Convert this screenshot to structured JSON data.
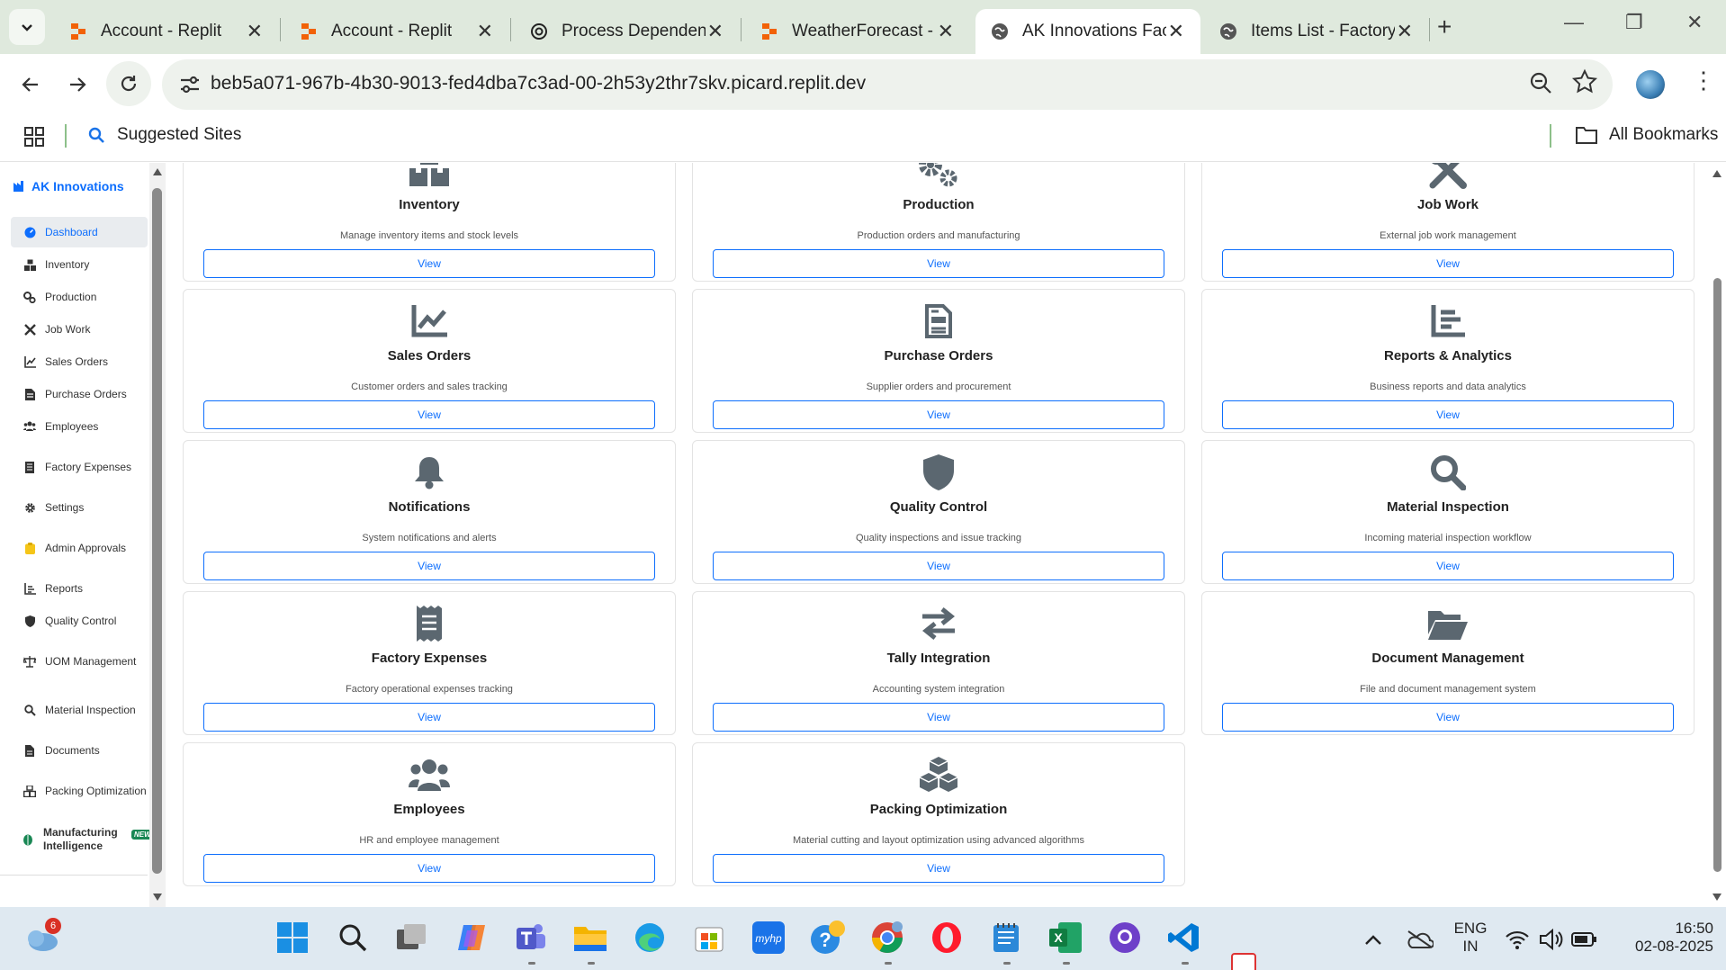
{
  "browser": {
    "tabs": [
      {
        "title": "Account - Replit",
        "favicon": "replit-icon",
        "active": false
      },
      {
        "title": "Account - Replit",
        "favicon": "replit-icon",
        "active": false
      },
      {
        "title": "Process Dependen",
        "favicon": "openai-icon",
        "active": false
      },
      {
        "title": "WeatherForecast -",
        "favicon": "replit-icon",
        "active": false
      },
      {
        "title": "AK Innovations Fac",
        "favicon": "globe-icon",
        "active": true
      },
      {
        "title": "Items List - Factory",
        "favicon": "globe-icon",
        "active": false
      }
    ],
    "url": "beb5a071-967b-4b30-9013-fed4dba7c3ad-00-2h53y2thr7skv.picard.replit.dev",
    "bookmarks": {
      "suggested": "Suggested Sites",
      "all": "All Bookmarks"
    }
  },
  "sidebar": {
    "brand": "AK Innovations",
    "items": [
      {
        "label": "Dashboard",
        "icon": "dashboard-icon",
        "active": true
      },
      {
        "label": "Inventory",
        "icon": "boxes-icon"
      },
      {
        "label": "Production",
        "icon": "cogs-icon"
      },
      {
        "label": "Job Work",
        "icon": "tools-icon"
      },
      {
        "label": "Sales Orders",
        "icon": "chart-line-icon"
      },
      {
        "label": "Purchase Orders",
        "icon": "file-invoice-icon"
      },
      {
        "label": "Employees",
        "icon": "users-icon"
      },
      {
        "label": "Factory Expenses",
        "icon": "receipt-icon"
      },
      {
        "label": "Settings",
        "icon": "gear-icon"
      },
      {
        "label": "Admin Approvals",
        "icon": "clipboard-icon"
      },
      {
        "label": "Reports",
        "icon": "chart-bar-icon"
      },
      {
        "label": "Quality Control",
        "icon": "shield-icon"
      },
      {
        "label": "UOM Management",
        "icon": "balance-scale-icon"
      },
      {
        "label": "Material Inspection",
        "icon": "search-icon"
      },
      {
        "label": "Documents",
        "icon": "file-icon"
      },
      {
        "label": "Packing Optimization",
        "icon": "cubes-icon"
      }
    ],
    "special": {
      "label_line1": "Manufacturing",
      "label_line2": "Intelligence",
      "badge": "NEW",
      "icon": "brain-icon"
    }
  },
  "cards": [
    {
      "title": "Inventory",
      "desc": "Manage inventory items and stock levels",
      "button": "View",
      "icon": "boxes-icon"
    },
    {
      "title": "Production",
      "desc": "Production orders and manufacturing",
      "button": "View",
      "icon": "cogs-icon"
    },
    {
      "title": "Job Work",
      "desc": "External job work management",
      "button": "View",
      "icon": "tools-icon"
    },
    {
      "title": "Sales Orders",
      "desc": "Customer orders and sales tracking",
      "button": "View",
      "icon": "chart-line-icon"
    },
    {
      "title": "Purchase Orders",
      "desc": "Supplier orders and procurement",
      "button": "View",
      "icon": "file-invoice-icon"
    },
    {
      "title": "Reports & Analytics",
      "desc": "Business reports and data analytics",
      "button": "View",
      "icon": "chart-bar-icon"
    },
    {
      "title": "Notifications",
      "desc": "System notifications and alerts",
      "button": "View",
      "icon": "bell-icon"
    },
    {
      "title": "Quality Control",
      "desc": "Quality inspections and issue tracking",
      "button": "View",
      "icon": "shield-icon"
    },
    {
      "title": "Material Inspection",
      "desc": "Incoming material inspection workflow",
      "button": "View",
      "icon": "search-icon"
    },
    {
      "title": "Factory Expenses",
      "desc": "Factory operational expenses tracking",
      "button": "View",
      "icon": "receipt-icon"
    },
    {
      "title": "Tally Integration",
      "desc": "Accounting system integration",
      "button": "View",
      "icon": "exchange-icon"
    },
    {
      "title": "Document Management",
      "desc": "File and document management system",
      "button": "View",
      "icon": "folder-open-icon"
    },
    {
      "title": "Employees",
      "desc": "HR and employee management",
      "button": "View",
      "icon": "users-icon"
    },
    {
      "title": "Packing Optimization",
      "desc": "Material cutting and layout optimization using advanced algorithms",
      "button": "View",
      "icon": "cubes-icon"
    }
  ],
  "taskbar": {
    "weather_badge": "6",
    "language_line1": "ENG",
    "language_line2": "IN",
    "time": "16:50",
    "date": "02-08-2025"
  },
  "colors": {
    "accent": "#0d6efd",
    "icon_gray": "#5b6770",
    "tabbar": "#dfe9dd",
    "taskbar": "#dfe9f1"
  }
}
